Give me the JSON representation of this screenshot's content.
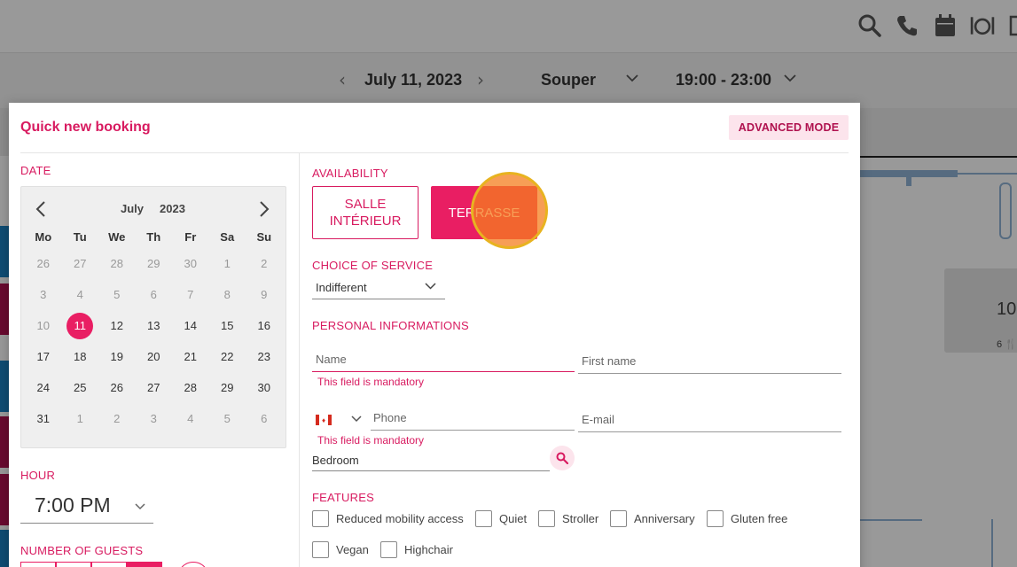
{
  "header": {
    "icons": [
      "search-icon",
      "phone-icon",
      "calendar-icon",
      "restaurant-icon",
      "list-icon"
    ]
  },
  "datebar": {
    "date": "July 11, 2023",
    "service": "Souper",
    "time_range": "19:00 - 23:00"
  },
  "floor": {
    "table_number": "10",
    "table_capacity": "6 🍴"
  },
  "modal": {
    "title": "Quick new booking",
    "advanced_mode_label": "ADVANCED MODE",
    "date_label": "DATE",
    "calendar": {
      "month": "July",
      "year": "2023",
      "weekdays": [
        "Mo",
        "Tu",
        "We",
        "Th",
        "Fr",
        "Sa",
        "Su"
      ],
      "weeks": [
        [
          [
            "26",
            true
          ],
          [
            "27",
            true
          ],
          [
            "28",
            true
          ],
          [
            "29",
            true
          ],
          [
            "30",
            true
          ],
          [
            "1",
            true
          ],
          [
            "2",
            true
          ]
        ],
        [
          [
            "3",
            true
          ],
          [
            "4",
            true
          ],
          [
            "5",
            true
          ],
          [
            "6",
            true
          ],
          [
            "7",
            true
          ],
          [
            "8",
            true
          ],
          [
            "9",
            true
          ]
        ],
        [
          [
            "10",
            true
          ],
          [
            "11",
            false
          ],
          [
            "12",
            false
          ],
          [
            "13",
            false
          ],
          [
            "14",
            false
          ],
          [
            "15",
            false
          ],
          [
            "16",
            false
          ]
        ],
        [
          [
            "17",
            false
          ],
          [
            "18",
            false
          ],
          [
            "19",
            false
          ],
          [
            "20",
            false
          ],
          [
            "21",
            false
          ],
          [
            "22",
            false
          ],
          [
            "23",
            false
          ]
        ],
        [
          [
            "24",
            false
          ],
          [
            "25",
            false
          ],
          [
            "26",
            false
          ],
          [
            "27",
            false
          ],
          [
            "28",
            false
          ],
          [
            "29",
            false
          ],
          [
            "30",
            false
          ]
        ],
        [
          [
            "31",
            false
          ],
          [
            "1",
            true
          ],
          [
            "2",
            true
          ],
          [
            "3",
            true
          ],
          [
            "4",
            true
          ],
          [
            "5",
            true
          ],
          [
            "6",
            true
          ]
        ]
      ],
      "selected_day": "11"
    },
    "hour_label": "HOUR",
    "hour_value": "7:00 PM",
    "guests_label": "NUMBER OF GUESTS",
    "availability_label": "AVAILABILITY",
    "rooms": [
      {
        "label": "SALLE INTÉRIEUR",
        "active": false
      },
      {
        "label": "TERRASSE",
        "active": true
      }
    ],
    "service_label": "CHOICE OF SERVICE",
    "service_value": "Indifferent",
    "personal_label": "PERSONAL INFORMATIONS",
    "fields": {
      "name_placeholder": "Name",
      "first_name_placeholder": "First name",
      "phone_placeholder": "Phone",
      "email_placeholder": "E-mail",
      "room_value": "Bedroom"
    },
    "error_mandatory": "This field is mandatory",
    "features_label": "FEATURES",
    "features": [
      "Reduced mobility access",
      "Quiet",
      "Stroller",
      "Anniversary",
      "Gluten free",
      "Vegan",
      "Highchair"
    ]
  },
  "colors": {
    "accent": "#e91e63",
    "accent_text": "#d81b60",
    "accent_light": "#fce4ec"
  }
}
